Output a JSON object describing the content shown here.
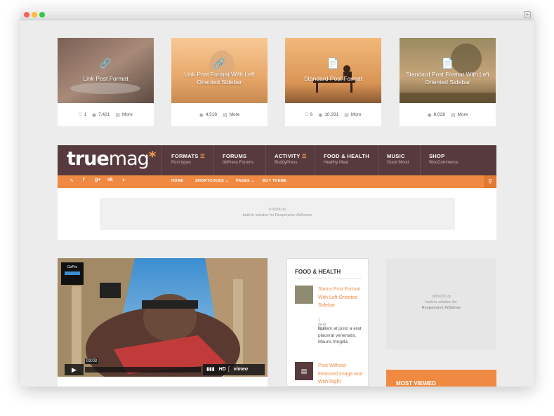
{
  "cards": [
    {
      "title": "Link Post Format",
      "icon": "link-icon",
      "stats": [
        {
          "icon": "comment-icon",
          "value": "1"
        },
        {
          "icon": "eye-icon",
          "value": "7,421"
        },
        {
          "icon": "document-icon",
          "value": "More"
        }
      ]
    },
    {
      "title": "Link Post Format With Left Oriented Sidebar",
      "icon": "link-icon",
      "stats": [
        {
          "icon": "eye-icon",
          "value": "4,518"
        },
        {
          "icon": "document-icon",
          "value": "More"
        }
      ]
    },
    {
      "title": "Standard Post Format",
      "icon": "document-icon",
      "stats": [
        {
          "icon": "comment-icon",
          "value": "6"
        },
        {
          "icon": "eye-icon",
          "value": "10,331"
        },
        {
          "icon": "document-icon",
          "value": "More"
        }
      ]
    },
    {
      "title": "Standard Post Format With Left Oriented Sidebar",
      "icon": "document-icon",
      "stats": [
        {
          "icon": "eye-icon",
          "value": "8,028"
        },
        {
          "icon": "document-icon",
          "value": "More"
        }
      ]
    }
  ],
  "header": {
    "logo_bold": "true",
    "logo_light": "mag",
    "logo_star": "*",
    "nav": [
      {
        "label": "FORMATS",
        "sub": "Post types",
        "has_menu": true
      },
      {
        "label": "FORUMS",
        "sub": "bbPress Forums",
        "has_menu": false
      },
      {
        "label": "ACTIVITY",
        "sub": "BuddyPress",
        "has_menu": true
      },
      {
        "label": "FOOD & HEALTH",
        "sub": "Healthy Meal",
        "has_menu": false
      },
      {
        "label": "MUSIC",
        "sub": "Good Mood",
        "has_menu": false
      },
      {
        "label": "SHOP",
        "sub": "WooCommerce",
        "has_menu": false
      }
    ]
  },
  "subbar": {
    "social": [
      "rss-icon",
      "facebook-icon",
      "google-plus-icon",
      "vk-icon",
      "twitter-icon"
    ],
    "links": [
      "HOME",
      "SHORTCODES ⌄",
      "PAGES ⌄",
      "BUY THEME"
    ]
  },
  "ad_banner": {
    "line1": "970x90 or",
    "line2": "built-in solution for Responsive AdSense"
  },
  "video": {
    "badge": "GoPro",
    "time": "03:03",
    "hd": "HD",
    "brand": "vimeo"
  },
  "widget": {
    "title": "FOOD & HEALTH",
    "posts": [
      {
        "title": "Status Post Format With Left Oriented Sidebar",
        "date": "1 year ago",
        "excerpt": "Nullam at justo a erat placerat venenatis. Mauris fringilla."
      },
      {
        "title": "Post Without Featured Image And With Right",
        "date": "",
        "excerpt": ""
      }
    ]
  },
  "right_ad": {
    "line1": "300x250 or",
    "line2": "built-in solution for",
    "line3": "Responsive AdSense"
  },
  "most_viewed": "MOST VIEWED",
  "colors": {
    "brand": "#573a3e",
    "accent": "#f08a42"
  }
}
